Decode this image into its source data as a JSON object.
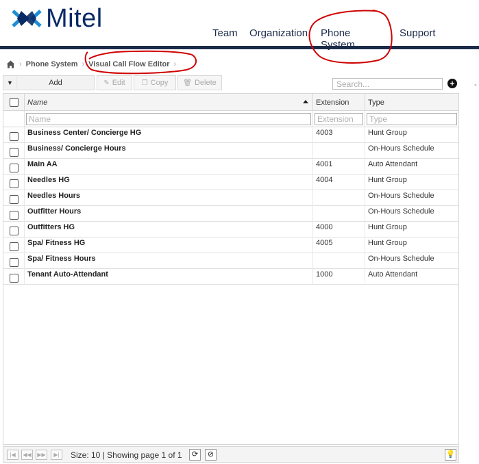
{
  "brand": {
    "name": "Mitel",
    "logo_color": "#0a2a66",
    "accent": "#1b2b4a"
  },
  "topnav": {
    "items": [
      {
        "label": "Team"
      },
      {
        "label": "Organization"
      },
      {
        "label": "Phone System"
      },
      {
        "label": "Support"
      }
    ]
  },
  "breadcrumb": {
    "home_icon": "home-icon",
    "items": [
      {
        "label": "Phone System"
      },
      {
        "label": "Visual Call Flow Editor"
      }
    ]
  },
  "toolbar": {
    "add_label": "Add",
    "edit_label": "Edit",
    "copy_label": "Copy",
    "delete_label": "Delete",
    "search_placeholder": "Search...",
    "dash": "-"
  },
  "grid": {
    "columns": {
      "name": "Name",
      "extension": "Extension",
      "type": "Type"
    },
    "filters": {
      "name_placeholder": "Name",
      "extension_placeholder": "Extension",
      "type_placeholder": "Type"
    },
    "rows": [
      {
        "name": "Business Center/ Concierge HG",
        "extension": "4003",
        "type": "Hunt Group"
      },
      {
        "name": "Business/ Concierge Hours",
        "extension": "",
        "type": "On-Hours Schedule"
      },
      {
        "name": "Main AA",
        "extension": "4001",
        "type": "Auto Attendant"
      },
      {
        "name": "Needles HG",
        "extension": "4004",
        "type": "Hunt Group"
      },
      {
        "name": "Needles Hours",
        "extension": "",
        "type": "On-Hours Schedule"
      },
      {
        "name": "Outfitter Hours",
        "extension": "",
        "type": "On-Hours Schedule"
      },
      {
        "name": "Outfitters HG",
        "extension": "4000",
        "type": "Hunt Group"
      },
      {
        "name": "Spa/ Fitness HG",
        "extension": "4005",
        "type": "Hunt Group"
      },
      {
        "name": "Spa/ Fitness Hours",
        "extension": "",
        "type": "On-Hours Schedule"
      },
      {
        "name": "Tenant Auto-Attendant",
        "extension": "1000",
        "type": "Auto Attendant"
      }
    ]
  },
  "pager": {
    "status": "Size: 10 | Showing page 1 of 1"
  },
  "annotation_color": "#d00000"
}
